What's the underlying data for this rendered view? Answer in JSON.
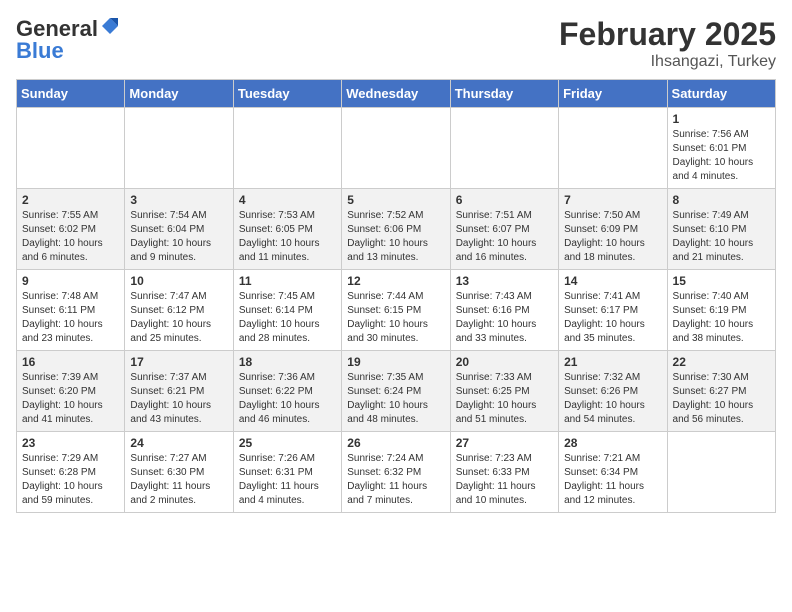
{
  "header": {
    "logo_general": "General",
    "logo_blue": "Blue",
    "title": "February 2025",
    "subtitle": "Ihsangazi, Turkey"
  },
  "columns": [
    "Sunday",
    "Monday",
    "Tuesday",
    "Wednesday",
    "Thursday",
    "Friday",
    "Saturday"
  ],
  "weeks": [
    [
      {
        "day": "",
        "info": ""
      },
      {
        "day": "",
        "info": ""
      },
      {
        "day": "",
        "info": ""
      },
      {
        "day": "",
        "info": ""
      },
      {
        "day": "",
        "info": ""
      },
      {
        "day": "",
        "info": ""
      },
      {
        "day": "1",
        "info": "Sunrise: 7:56 AM\nSunset: 6:01 PM\nDaylight: 10 hours and 4 minutes."
      }
    ],
    [
      {
        "day": "2",
        "info": "Sunrise: 7:55 AM\nSunset: 6:02 PM\nDaylight: 10 hours and 6 minutes."
      },
      {
        "day": "3",
        "info": "Sunrise: 7:54 AM\nSunset: 6:04 PM\nDaylight: 10 hours and 9 minutes."
      },
      {
        "day": "4",
        "info": "Sunrise: 7:53 AM\nSunset: 6:05 PM\nDaylight: 10 hours and 11 minutes."
      },
      {
        "day": "5",
        "info": "Sunrise: 7:52 AM\nSunset: 6:06 PM\nDaylight: 10 hours and 13 minutes."
      },
      {
        "day": "6",
        "info": "Sunrise: 7:51 AM\nSunset: 6:07 PM\nDaylight: 10 hours and 16 minutes."
      },
      {
        "day": "7",
        "info": "Sunrise: 7:50 AM\nSunset: 6:09 PM\nDaylight: 10 hours and 18 minutes."
      },
      {
        "day": "8",
        "info": "Sunrise: 7:49 AM\nSunset: 6:10 PM\nDaylight: 10 hours and 21 minutes."
      }
    ],
    [
      {
        "day": "9",
        "info": "Sunrise: 7:48 AM\nSunset: 6:11 PM\nDaylight: 10 hours and 23 minutes."
      },
      {
        "day": "10",
        "info": "Sunrise: 7:47 AM\nSunset: 6:12 PM\nDaylight: 10 hours and 25 minutes."
      },
      {
        "day": "11",
        "info": "Sunrise: 7:45 AM\nSunset: 6:14 PM\nDaylight: 10 hours and 28 minutes."
      },
      {
        "day": "12",
        "info": "Sunrise: 7:44 AM\nSunset: 6:15 PM\nDaylight: 10 hours and 30 minutes."
      },
      {
        "day": "13",
        "info": "Sunrise: 7:43 AM\nSunset: 6:16 PM\nDaylight: 10 hours and 33 minutes."
      },
      {
        "day": "14",
        "info": "Sunrise: 7:41 AM\nSunset: 6:17 PM\nDaylight: 10 hours and 35 minutes."
      },
      {
        "day": "15",
        "info": "Sunrise: 7:40 AM\nSunset: 6:19 PM\nDaylight: 10 hours and 38 minutes."
      }
    ],
    [
      {
        "day": "16",
        "info": "Sunrise: 7:39 AM\nSunset: 6:20 PM\nDaylight: 10 hours and 41 minutes."
      },
      {
        "day": "17",
        "info": "Sunrise: 7:37 AM\nSunset: 6:21 PM\nDaylight: 10 hours and 43 minutes."
      },
      {
        "day": "18",
        "info": "Sunrise: 7:36 AM\nSunset: 6:22 PM\nDaylight: 10 hours and 46 minutes."
      },
      {
        "day": "19",
        "info": "Sunrise: 7:35 AM\nSunset: 6:24 PM\nDaylight: 10 hours and 48 minutes."
      },
      {
        "day": "20",
        "info": "Sunrise: 7:33 AM\nSunset: 6:25 PM\nDaylight: 10 hours and 51 minutes."
      },
      {
        "day": "21",
        "info": "Sunrise: 7:32 AM\nSunset: 6:26 PM\nDaylight: 10 hours and 54 minutes."
      },
      {
        "day": "22",
        "info": "Sunrise: 7:30 AM\nSunset: 6:27 PM\nDaylight: 10 hours and 56 minutes."
      }
    ],
    [
      {
        "day": "23",
        "info": "Sunrise: 7:29 AM\nSunset: 6:28 PM\nDaylight: 10 hours and 59 minutes."
      },
      {
        "day": "24",
        "info": "Sunrise: 7:27 AM\nSunset: 6:30 PM\nDaylight: 11 hours and 2 minutes."
      },
      {
        "day": "25",
        "info": "Sunrise: 7:26 AM\nSunset: 6:31 PM\nDaylight: 11 hours and 4 minutes."
      },
      {
        "day": "26",
        "info": "Sunrise: 7:24 AM\nSunset: 6:32 PM\nDaylight: 11 hours and 7 minutes."
      },
      {
        "day": "27",
        "info": "Sunrise: 7:23 AM\nSunset: 6:33 PM\nDaylight: 11 hours and 10 minutes."
      },
      {
        "day": "28",
        "info": "Sunrise: 7:21 AM\nSunset: 6:34 PM\nDaylight: 11 hours and 12 minutes."
      },
      {
        "day": "",
        "info": ""
      }
    ]
  ]
}
